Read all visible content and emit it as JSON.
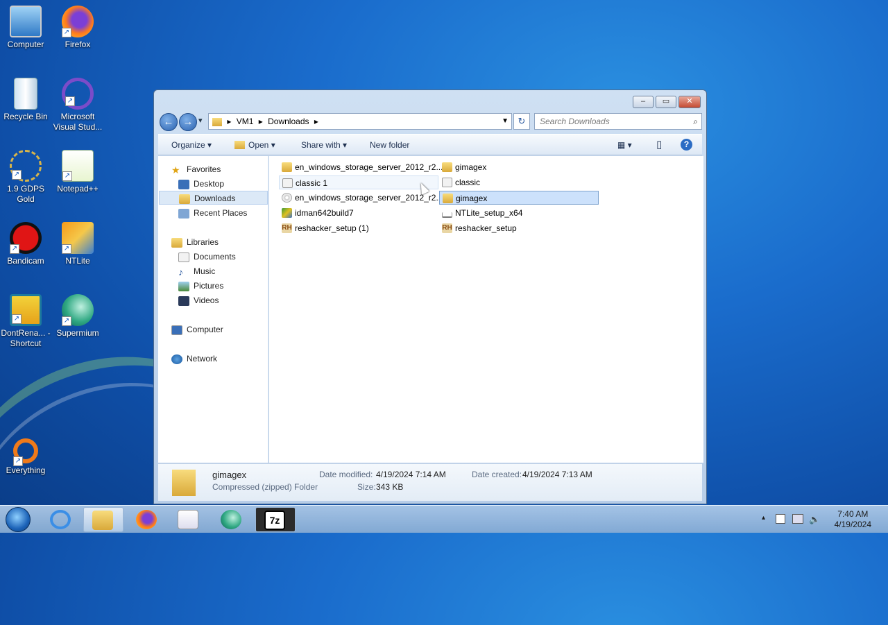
{
  "desktop": {
    "icons": [
      {
        "label": "Computer",
        "icon": "computer-icon"
      },
      {
        "label": "Firefox",
        "icon": "firefox-icon"
      },
      {
        "label": "Recycle Bin",
        "icon": "recycle-bin-icon"
      },
      {
        "label": "Microsoft Visual Stud...",
        "icon": "visual-studio-icon"
      },
      {
        "label": "1.9 GDPS Gold",
        "icon": "gdps-icon"
      },
      {
        "label": "Notepad++",
        "icon": "notepadpp-icon"
      },
      {
        "label": "Bandicam",
        "icon": "bandicam-icon"
      },
      {
        "label": "NTLite",
        "icon": "ntlite-icon"
      },
      {
        "label": "DontRena... - Shortcut",
        "icon": "geometry-dash-icon"
      },
      {
        "label": "Supermium",
        "icon": "supermium-icon"
      },
      {
        "label": "Everything",
        "icon": "everything-icon"
      }
    ]
  },
  "window": {
    "caption": {
      "minimize": "–",
      "maximize": "▭",
      "close": "✕"
    },
    "nav": {
      "back": "←",
      "forward": "→",
      "history": "▾"
    },
    "address": {
      "seg1": "VM1",
      "seg2": "Downloads",
      "sep": "▸"
    },
    "refresh": "↻",
    "search": {
      "placeholder": "Search Downloads",
      "icon": "⌕"
    },
    "toolbar": {
      "organize": "Organize ▾",
      "open": "Open ▾",
      "share": "Share with ▾",
      "new_folder": "New folder",
      "views": "▦ ▾",
      "preview": "▯",
      "help": "?"
    },
    "nav_pane": {
      "favorites": "Favorites",
      "desktop": "Desktop",
      "downloads": "Downloads",
      "recent": "Recent Places",
      "libraries": "Libraries",
      "documents": "Documents",
      "music": "Music",
      "pictures": "Pictures",
      "videos": "Videos",
      "computer": "Computer",
      "network": "Network"
    },
    "files": [
      {
        "name": "en_windows_storage_server_2012_r2...",
        "type": "folder"
      },
      {
        "name": "gimagex",
        "type": "folder"
      },
      {
        "name": "classic 1",
        "type": "doc"
      },
      {
        "name": "classic",
        "type": "doc"
      },
      {
        "name": "en_windows_storage_server_2012_r2...",
        "type": "iso"
      },
      {
        "name": "gimagex",
        "type": "zip"
      },
      {
        "name": "idman642build7",
        "type": "exe"
      },
      {
        "name": "NTLite_setup_x64",
        "type": "exe"
      },
      {
        "name": "reshacker_setup (1)",
        "type": "rh"
      },
      {
        "name": "reshacker_setup",
        "type": "rh"
      }
    ],
    "details": {
      "name": "gimagex",
      "type": "Compressed (zipped) Folder",
      "modified_label": "Date modified:",
      "modified_value": "4/19/2024 7:14 AM",
      "created_label": "Date created:",
      "created_value": "4/19/2024 7:13 AM",
      "size_label": "Size:",
      "size_value": "343 KB"
    }
  },
  "taskbar": {
    "time": "7:40 AM",
    "date": "4/19/2024",
    "tray_up": "▴",
    "colors": {
      "accent": "#1c63b8"
    }
  }
}
